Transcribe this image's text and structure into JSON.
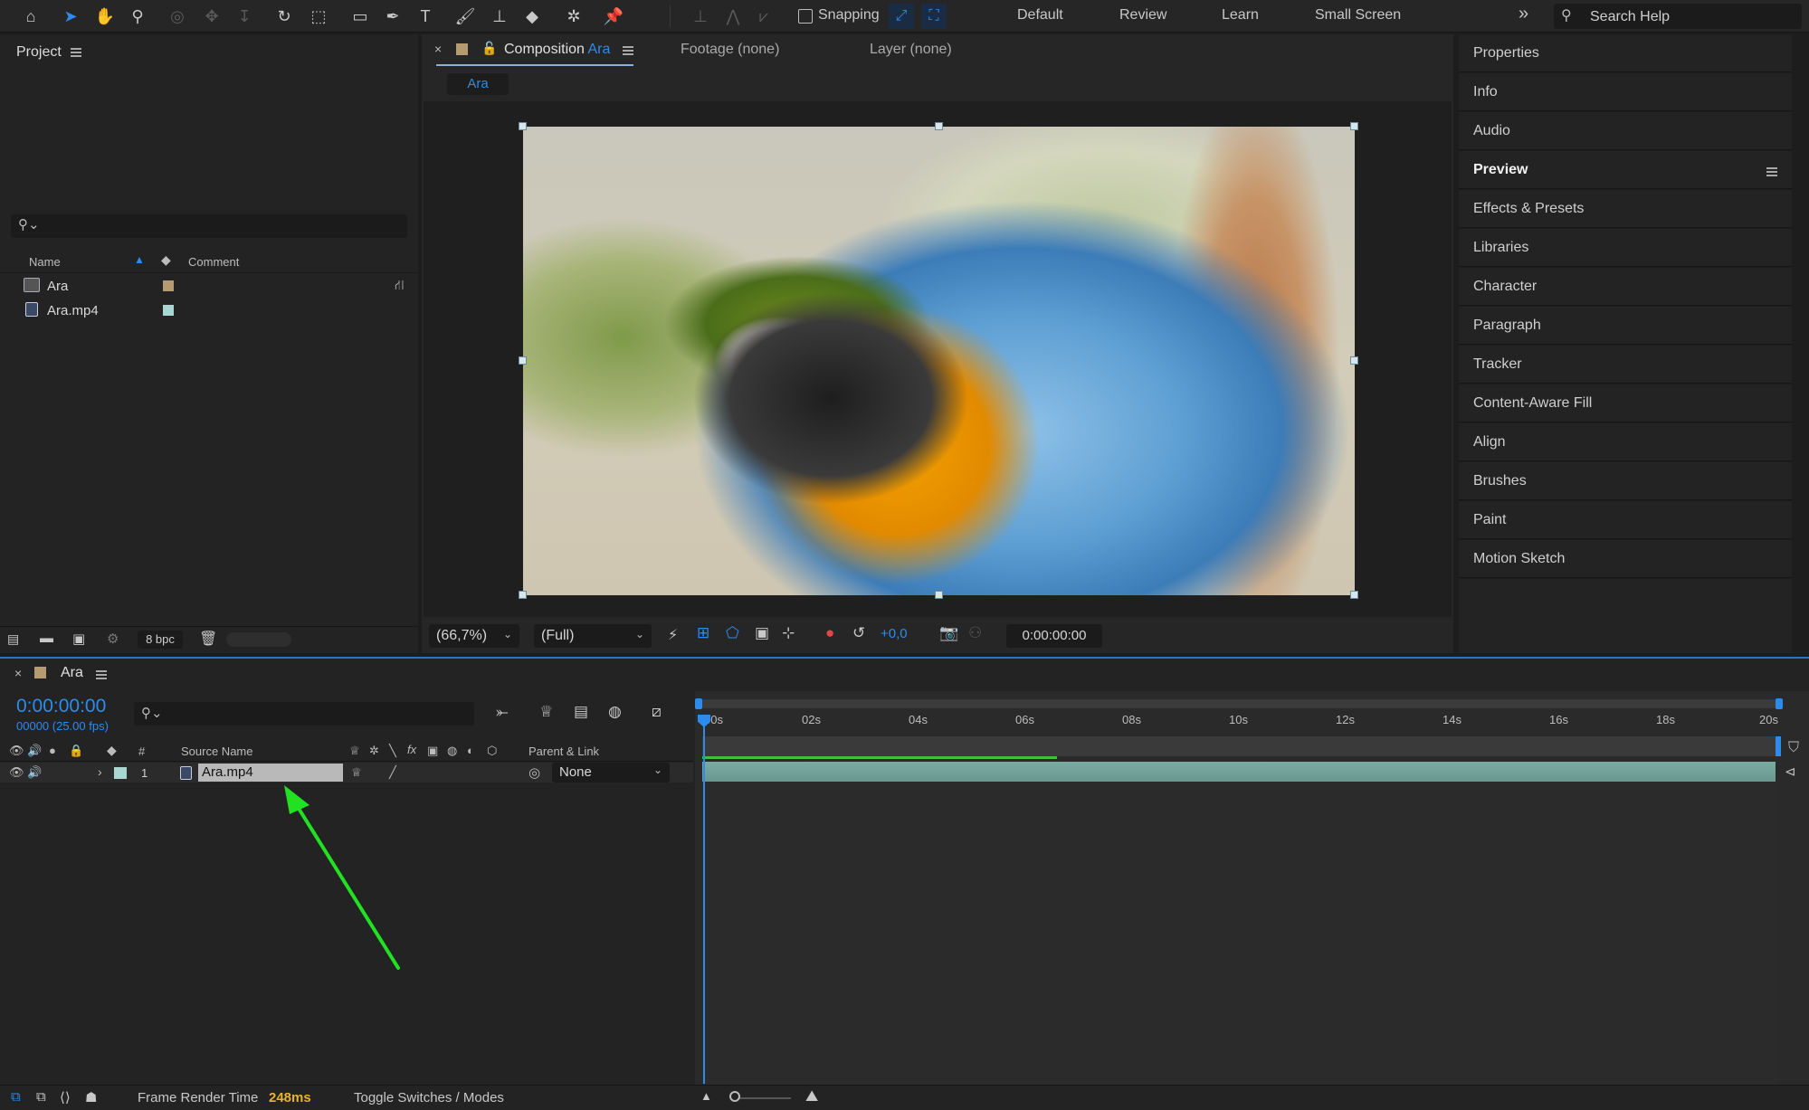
{
  "toolbar": {
    "snapping_label": "Snapping",
    "workspaces": [
      "Default",
      "Review",
      "Learn",
      "Small Screen"
    ],
    "search_placeholder": "Search Help",
    "icons": [
      "home-icon",
      "selection-tool-icon",
      "hand-tool-icon",
      "zoom-tool-icon",
      "orbit-camera-icon",
      "pan-camera-icon",
      "dolly-camera-icon",
      "rotate-tool-icon",
      "pan-behind-icon",
      "rectangle-tool-icon",
      "pen-tool-icon",
      "type-tool-icon",
      "brush-tool-icon",
      "clone-stamp-icon",
      "eraser-tool-icon",
      "roto-brush-icon",
      "puppet-pin-icon"
    ]
  },
  "project": {
    "title": "Project",
    "col_name": "Name",
    "col_comment": "Comment",
    "items": [
      {
        "name": "Ara",
        "type": "composition",
        "label_color": "#b59a72"
      },
      {
        "name": "Ara.mp4",
        "type": "footage",
        "label_color": "#a9d6d2"
      }
    ],
    "bpc": "8 bpc"
  },
  "comp": {
    "tab_prefix": "Composition",
    "tab_name": "Ara",
    "footage_tab": "Footage (none)",
    "layer_tab": "Layer (none)",
    "comp_chip": "Ara",
    "zoom": "(66,7%)",
    "resolution": "(Full)",
    "exposure": "+0,0",
    "timecode": "0:00:00:00"
  },
  "right_panels": [
    {
      "label": "Properties",
      "bold": false
    },
    {
      "label": "Info",
      "bold": false
    },
    {
      "label": "Audio",
      "bold": false
    },
    {
      "label": "Preview",
      "bold": true
    },
    {
      "label": "Effects & Presets",
      "bold": false
    },
    {
      "label": "Libraries",
      "bold": false
    },
    {
      "label": "Character",
      "bold": false
    },
    {
      "label": "Paragraph",
      "bold": false
    },
    {
      "label": "Tracker",
      "bold": false
    },
    {
      "label": "Content-Aware Fill",
      "bold": false
    },
    {
      "label": "Align",
      "bold": false
    },
    {
      "label": "Brushes",
      "bold": false
    },
    {
      "label": "Paint",
      "bold": false
    },
    {
      "label": "Motion Sketch",
      "bold": false
    }
  ],
  "timeline": {
    "comp_name": "Ara",
    "timecode": "0:00:00:00",
    "frames_fps": "00000 (25.00 fps)",
    "col_num": "#",
    "col_source": "Source Name",
    "col_parent": "Parent & Link",
    "layer": {
      "index": "1",
      "name": "Ara.mp4",
      "parent": "None",
      "label_color": "#a9d6d2"
    },
    "ruler": [
      "00s",
      "02s",
      "04s",
      "06s",
      "08s",
      "10s",
      "12s",
      "14s",
      "16s",
      "18s",
      "20s"
    ],
    "frame_render_label": "Frame Render Time",
    "frame_render_value": "248ms",
    "toggle_label": "Toggle Switches / Modes",
    "accent": "#2d8ceb",
    "render_accent": "#e8b42a"
  }
}
